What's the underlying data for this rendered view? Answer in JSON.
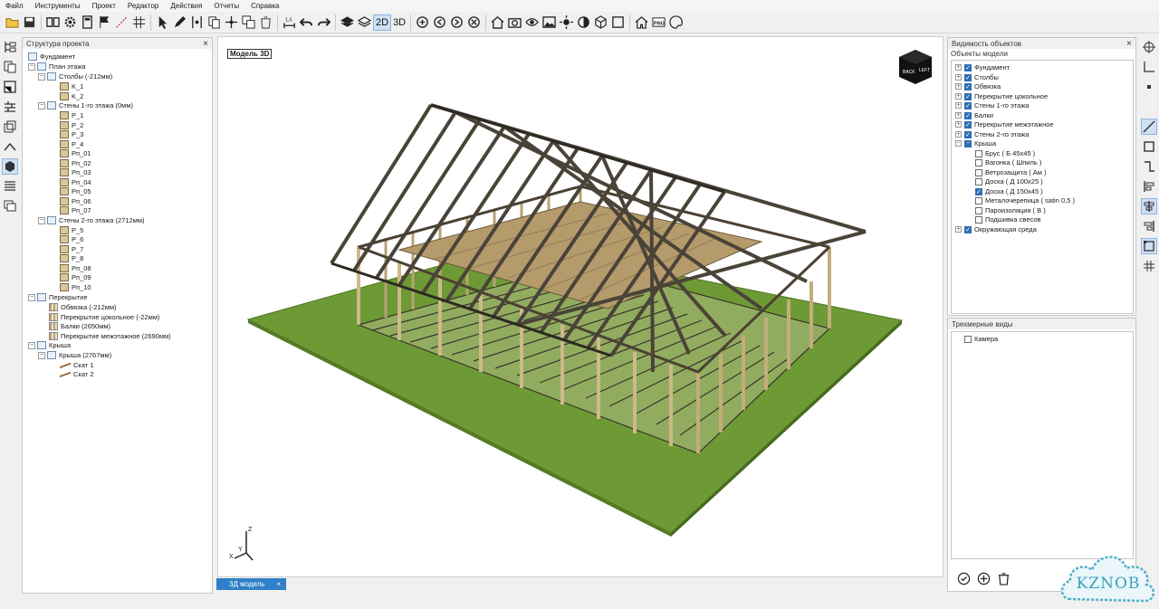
{
  "menu": [
    "Файл",
    "Инструменты",
    "Проект",
    "Редактор",
    "Действия",
    "Отчеты",
    "Справка"
  ],
  "toolbar": {
    "mode_2d": "2D",
    "mode_3d": "3D"
  },
  "tree_panel": {
    "title": "Структура проекта",
    "rows": [
      {
        "label": "Фундамент"
      },
      {
        "label": "План этажа"
      },
      {
        "label": "Столбы (-212мм)"
      },
      {
        "label": "K_1"
      },
      {
        "label": "K_2"
      },
      {
        "label": "Стены 1-го этажа (0мм)"
      },
      {
        "label": "P_1"
      },
      {
        "label": "P_2"
      },
      {
        "label": "P_3"
      },
      {
        "label": "P_4"
      },
      {
        "label": "Pп_01"
      },
      {
        "label": "Pп_02"
      },
      {
        "label": "Pп_03"
      },
      {
        "label": "Pп_04"
      },
      {
        "label": "Pп_05"
      },
      {
        "label": "Pп_06"
      },
      {
        "label": "Pп_07"
      },
      {
        "label": "Стены 2-го этажа (2712мм)"
      },
      {
        "label": "P_5"
      },
      {
        "label": "P_6"
      },
      {
        "label": "P_7"
      },
      {
        "label": "P_8"
      },
      {
        "label": "Pп_08"
      },
      {
        "label": "Pп_09"
      },
      {
        "label": "Pп_10"
      },
      {
        "label": "Перекрытие"
      },
      {
        "label": "Обвязка (-212мм)"
      },
      {
        "label": "Перекрытие цокольное (-22мм)"
      },
      {
        "label": "Балки (2650мм)"
      },
      {
        "label": "Перекрытие межэтажное (2690мм)"
      },
      {
        "label": "Крыша"
      },
      {
        "label": "Крыша (2767мм)"
      },
      {
        "label": "Скат 1"
      },
      {
        "label": "Скат 2"
      }
    ]
  },
  "viewport": {
    "label": "Модель 3D",
    "cube_face": "BACK",
    "cube_side": "LEFT",
    "axis_z": "Z",
    "axis_x": "X",
    "axis_y": "Y"
  },
  "bottom_tab": {
    "label": "3Д модель",
    "close": "×"
  },
  "visibility_panel": {
    "title": "Видимость объектов",
    "subtitle": "Объекты модели",
    "items": [
      {
        "label": "Фундамент",
        "checked": true
      },
      {
        "label": "Столбы",
        "checked": true
      },
      {
        "label": "Обвязка",
        "checked": true
      },
      {
        "label": "Перекрытие цокольное",
        "checked": true
      },
      {
        "label": "Стены 1-го этажа",
        "checked": true
      },
      {
        "label": "Балки",
        "checked": true
      },
      {
        "label": "Перекрытие межэтажное",
        "checked": true
      },
      {
        "label": "Стены 2-го этажа",
        "checked": true
      },
      {
        "label": "Крыша",
        "checked": "partial"
      },
      {
        "label": "Брус ( Б 45х45 )",
        "checked": false
      },
      {
        "label": "Вагонка ( Шпиль )",
        "checked": false
      },
      {
        "label": "Ветрозащита ( Ам )",
        "checked": false
      },
      {
        "label": "Доска ( Д 100х25 )",
        "checked": false
      },
      {
        "label": "Доска ( Д 150х45 )",
        "checked": true
      },
      {
        "label": "Металочерепица ( satin 0,5 )",
        "checked": false
      },
      {
        "label": "Пароизоляция ( В )",
        "checked": false
      },
      {
        "label": "Подшивка свесов",
        "checked": false
      },
      {
        "label": "Окружающая среда",
        "checked": true
      }
    ]
  },
  "views_panel": {
    "title": "Трехмерные виды",
    "items": [
      {
        "label": "Камера",
        "checked": false
      }
    ]
  },
  "logo": {
    "text": "KZNOB"
  },
  "colors": {
    "accent": "#2f80c8",
    "grass": "#6d9a35",
    "timber": "#c9b587",
    "roof": "#4a4338"
  }
}
